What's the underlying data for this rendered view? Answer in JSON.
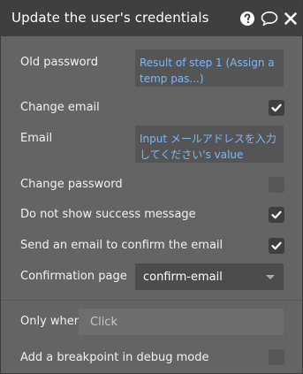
{
  "header": {
    "title": "Update the user's credentials"
  },
  "icons": {
    "help": "help-circle-icon",
    "comment": "comment-bubble-icon",
    "close": "close-x-icon"
  },
  "fields": {
    "old_password": {
      "label": "Old password",
      "value": "Result of step 1 (Assign a temp pas...)"
    },
    "change_email": {
      "label": "Change email",
      "checked": true
    },
    "email": {
      "label": "Email",
      "value": "Input メールアドレスを入力してください's value"
    },
    "change_password": {
      "label": "Change password",
      "checked": false
    },
    "no_success_msg": {
      "label": "Do not show success message",
      "checked": true
    },
    "send_confirm": {
      "label": "Send an email to confirm the email",
      "checked": true
    },
    "confirmation_page": {
      "label": "Confirmation page",
      "value": "confirm-email"
    },
    "only_when": {
      "label": "Only when",
      "placeholder": "Click"
    },
    "breakpoint": {
      "label": "Add a breakpoint in debug mode",
      "checked": false
    }
  },
  "colors": {
    "header_bg": "#3f3f3f",
    "panel_bg": "#646464",
    "link_blue": "#7fb8f7"
  }
}
